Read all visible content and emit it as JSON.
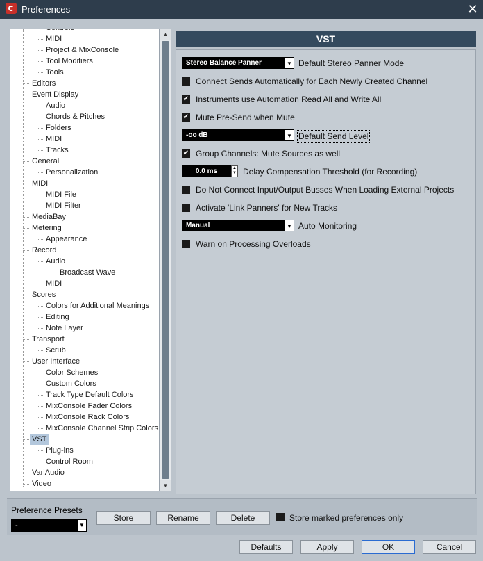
{
  "window": {
    "title": "Preferences",
    "close_glyph": "✕"
  },
  "tree": {
    "items": [
      {
        "label": "Controls",
        "level": 2
      },
      {
        "label": "MIDI",
        "level": 2
      },
      {
        "label": "Project & MixConsole",
        "level": 2
      },
      {
        "label": "Tool Modifiers",
        "level": 2
      },
      {
        "label": "Tools",
        "level": 2
      },
      {
        "label": "Editors",
        "level": 1
      },
      {
        "label": "Event Display",
        "level": 1
      },
      {
        "label": "Audio",
        "level": 2
      },
      {
        "label": "Chords & Pitches",
        "level": 2
      },
      {
        "label": "Folders",
        "level": 2
      },
      {
        "label": "MIDI",
        "level": 2
      },
      {
        "label": "Tracks",
        "level": 2
      },
      {
        "label": "General",
        "level": 1
      },
      {
        "label": "Personalization",
        "level": 2
      },
      {
        "label": "MIDI",
        "level": 1
      },
      {
        "label": "MIDI File",
        "level": 2
      },
      {
        "label": "MIDI Filter",
        "level": 2
      },
      {
        "label": "MediaBay",
        "level": 1
      },
      {
        "label": "Metering",
        "level": 1
      },
      {
        "label": "Appearance",
        "level": 2
      },
      {
        "label": "Record",
        "level": 1
      },
      {
        "label": "Audio",
        "level": 2
      },
      {
        "label": "Broadcast Wave",
        "level": 3
      },
      {
        "label": "MIDI",
        "level": 2
      },
      {
        "label": "Scores",
        "level": 1
      },
      {
        "label": "Colors for Additional Meanings",
        "level": 2
      },
      {
        "label": "Editing",
        "level": 2
      },
      {
        "label": "Note Layer",
        "level": 2
      },
      {
        "label": "Transport",
        "level": 1
      },
      {
        "label": "Scrub",
        "level": 2
      },
      {
        "label": "User Interface",
        "level": 1
      },
      {
        "label": "Color Schemes",
        "level": 2
      },
      {
        "label": "Custom Colors",
        "level": 2
      },
      {
        "label": "Track Type Default Colors",
        "level": 2
      },
      {
        "label": "MixConsole Fader Colors",
        "level": 2
      },
      {
        "label": "MixConsole Rack Colors",
        "level": 2
      },
      {
        "label": "MixConsole Channel Strip Colors",
        "level": 2
      },
      {
        "label": "VST",
        "level": 1,
        "selected": true
      },
      {
        "label": "Plug-ins",
        "level": 2
      },
      {
        "label": "Control Room",
        "level": 2
      },
      {
        "label": "VariAudio",
        "level": 1
      },
      {
        "label": "Video",
        "level": 1
      }
    ]
  },
  "vst": {
    "title": "VST",
    "panner_mode_value": "Stereo Balance Panner",
    "panner_mode_label": "Default Stereo Panner Mode",
    "connect_sends_label": "Connect Sends Automatically for Each Newly Created Channel",
    "connect_sends_checked": false,
    "instruments_automation_label": "Instruments use Automation Read All and Write All",
    "instruments_automation_checked": true,
    "mute_presend_label": "Mute Pre-Send when Mute",
    "mute_presend_checked": true,
    "send_level_value": "-oo dB",
    "send_level_label": "Default Send Level",
    "group_mute_label": "Group Channels: Mute Sources as well",
    "group_mute_checked": true,
    "delay_comp_value": "0.0 ms",
    "delay_comp_label": "Delay Compensation Threshold (for Recording)",
    "no_connect_label": "Do Not Connect Input/Output Busses When Loading External Projects",
    "no_connect_checked": false,
    "link_panners_label": "Activate 'Link Panners' for New Tracks",
    "link_panners_checked": false,
    "auto_monitoring_value": "Manual",
    "auto_monitoring_label": "Auto Monitoring",
    "warn_overloads_label": "Warn on Processing Overloads",
    "warn_overloads_checked": false
  },
  "presets": {
    "label": "Preference Presets",
    "selected": "-",
    "store": "Store",
    "rename": "Rename",
    "delete": "Delete",
    "store_marked_label": "Store marked preferences only",
    "store_marked_checked": false
  },
  "footer": {
    "defaults": "Defaults",
    "apply": "Apply",
    "ok": "OK",
    "cancel": "Cancel"
  },
  "glyphs": {
    "dropdown_arrow": "▼",
    "check": "✔",
    "up": "▲",
    "down": "▼"
  },
  "colors": {
    "titlebar": "#2e3d4c",
    "header": "#344a5e",
    "selection": "#b3c7dc",
    "accent": "#2a6bd1"
  }
}
